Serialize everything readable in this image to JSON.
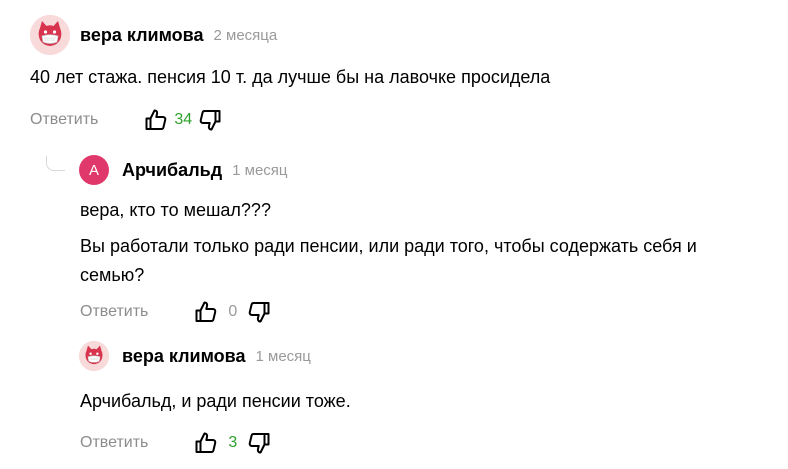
{
  "comments": [
    {
      "author": "вера климова",
      "time": "2 месяца",
      "lines": [
        "40 лет стажа. пенсия 10 т. да лучше бы на лавочке просидела"
      ],
      "reply_label": "Ответить",
      "likes": "34"
    },
    {
      "author": "Арчибальд",
      "avatar_letter": "А",
      "time": "1 месяц",
      "lines": [
        "вера, кто то мешал???",
        "Вы работали только ради пенсии, или ради того, чтобы содержать себя и",
        "семью?"
      ],
      "reply_label": "Ответить",
      "likes": "0"
    },
    {
      "author": "вера климова",
      "time": "1 месяц",
      "lines": [
        "Арчибальд, и ради пенсии тоже."
      ],
      "reply_label": "Ответить",
      "likes": "3"
    }
  ],
  "icons": {
    "avatar_cat": "cat-mask-avatar-icon",
    "like": "thumbs-up-icon",
    "dislike": "thumbs-down-icon"
  },
  "colors": {
    "like_count_positive": "#2ea12e",
    "like_count_zero": "#9a9a9a",
    "letter_avatar": "#e0386b",
    "muted_text": "#8c8c8c"
  }
}
